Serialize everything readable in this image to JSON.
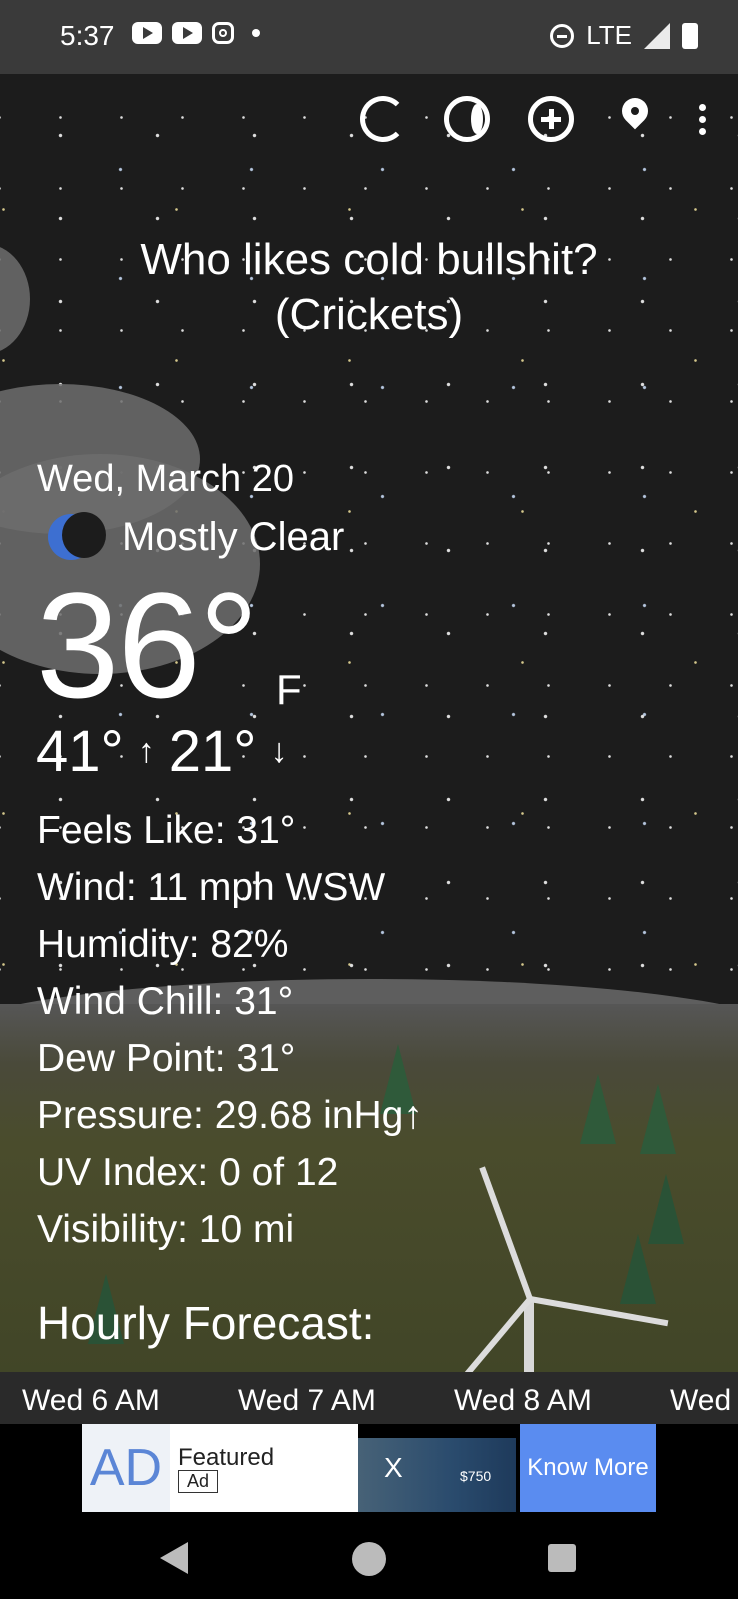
{
  "status_bar": {
    "time": "5:37",
    "network": "LTE"
  },
  "toolbar": {
    "icons": [
      "refresh-icon",
      "moon-phase-icon",
      "add-location-icon",
      "location-pin-icon",
      "more-options-icon"
    ]
  },
  "headline": {
    "line1": "Who likes cold bullshit?",
    "line2": "(Crickets)"
  },
  "current": {
    "date": "Wed, March 20",
    "condition": "Mostly Clear",
    "temperature": "36°",
    "unit": "F",
    "high": "41°",
    "high_arrow": "↑",
    "low": "21°",
    "low_arrow": "↓"
  },
  "details": [
    "Feels Like:  31°",
    "Wind:  11 mph WSW",
    "Humidity:  82%",
    "Wind Chill:  31°",
    "Dew Point:  31°",
    "Pressure:  29.68 inHg↑",
    "UV Index:  0 of 12",
    "Visibility:  10 mi"
  ],
  "hourly": {
    "title": "Hourly Forecast:",
    "hours": [
      "Wed 6 AM",
      "Wed 7 AM",
      "Wed 8 AM",
      "Wed"
    ]
  },
  "ad": {
    "logo": "AD",
    "featured": "Featured",
    "tag": "Ad",
    "close": "X",
    "price": "$750",
    "cta": "Know More"
  },
  "colors": {
    "moon_accent": "#3d6fd1",
    "ad_cta": "#5a8cf0",
    "status_bar": "#3a3a3a"
  }
}
